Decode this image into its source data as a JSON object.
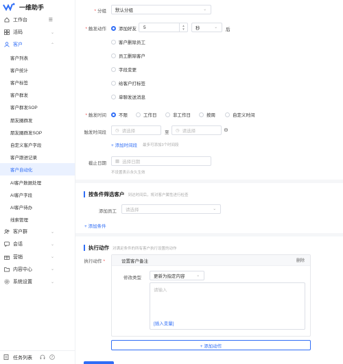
{
  "app": {
    "title": "一维助手"
  },
  "sidebar": {
    "items": [
      {
        "label": "工作台",
        "icon": "home-icon",
        "collapse": "☰"
      },
      {
        "label": "活码",
        "icon": "grid-icon",
        "arrow": "⌄"
      },
      {
        "label": "客户",
        "icon": "user-icon",
        "arrow": "⌃"
      }
    ],
    "sub_items": [
      "客户列表",
      "客户统计",
      "客户标签",
      "客户群发",
      "客户群发SOP",
      "朋友圈群发",
      "朋友圈群发SOP",
      "自定义客户字段",
      "客户跟进记录",
      "客户自动化",
      "AI客户数据处理",
      "AI客户字段",
      "AI客户待办",
      "线索管理"
    ],
    "bottom_items": [
      {
        "label": "客户群",
        "icon": "group-icon",
        "arrow": "⌄"
      },
      {
        "label": "会话",
        "icon": "chat-icon",
        "arrow": "⌄"
      },
      {
        "label": "营销",
        "icon": "gift-icon",
        "arrow": "⌄"
      },
      {
        "label": "内容中心",
        "icon": "folder-icon",
        "arrow": "⌄"
      },
      {
        "label": "系统设置",
        "icon": "gear-icon",
        "arrow": "⌄"
      }
    ],
    "footer": {
      "label": "任务列表",
      "icons": [
        "headset-icon",
        "help-icon"
      ]
    }
  },
  "form": {
    "group": {
      "label": "分组",
      "value": "默认分组"
    },
    "trigger_action": {
      "label": "触发动作",
      "options": [
        "添加好友",
        "客户删除员工",
        "员工删除客户",
        "字段变更",
        "给客户打标签",
        "单聊发送消息"
      ],
      "selected": "添加好友",
      "number": "5",
      "unit": "秒",
      "suffix": "后"
    },
    "trigger_time": {
      "label": "触发时间",
      "options": [
        "不限",
        "工作日",
        "非工作日",
        "按周",
        "自定义时间"
      ],
      "selected": "不限"
    },
    "time_range": {
      "label": "触发时间段",
      "start_placeholder": "请选择",
      "to": "至",
      "end_placeholder": "请选择",
      "add_link": "+ 添加时间段",
      "hint": "最多可添加3个时间段"
    },
    "deadline": {
      "label": "截止日期",
      "placeholder": "选择日期",
      "hint": "不设置表示永久生效"
    }
  },
  "filter": {
    "title": "按条件筛选客户",
    "desc": "到达时间后，将对客户属性进行检查",
    "employee_label": "添加员工",
    "employee_placeholder": "请选择",
    "add_condition": "+ 添加条件"
  },
  "actions": {
    "title": "执行动作",
    "desc": "对满足条件的所有客户执行设置的动作",
    "label": "执行动作",
    "card": {
      "title": "设置客户备注",
      "delete": "删除",
      "modify_label": "修改类型",
      "modify_value": "更新为指定内容",
      "input_placeholder": "请输入",
      "insert_var": "[插入变量]"
    },
    "add_action": "+ 添加动作"
  },
  "colors": {
    "accent": "#2f6df6",
    "required": "#f04848"
  }
}
